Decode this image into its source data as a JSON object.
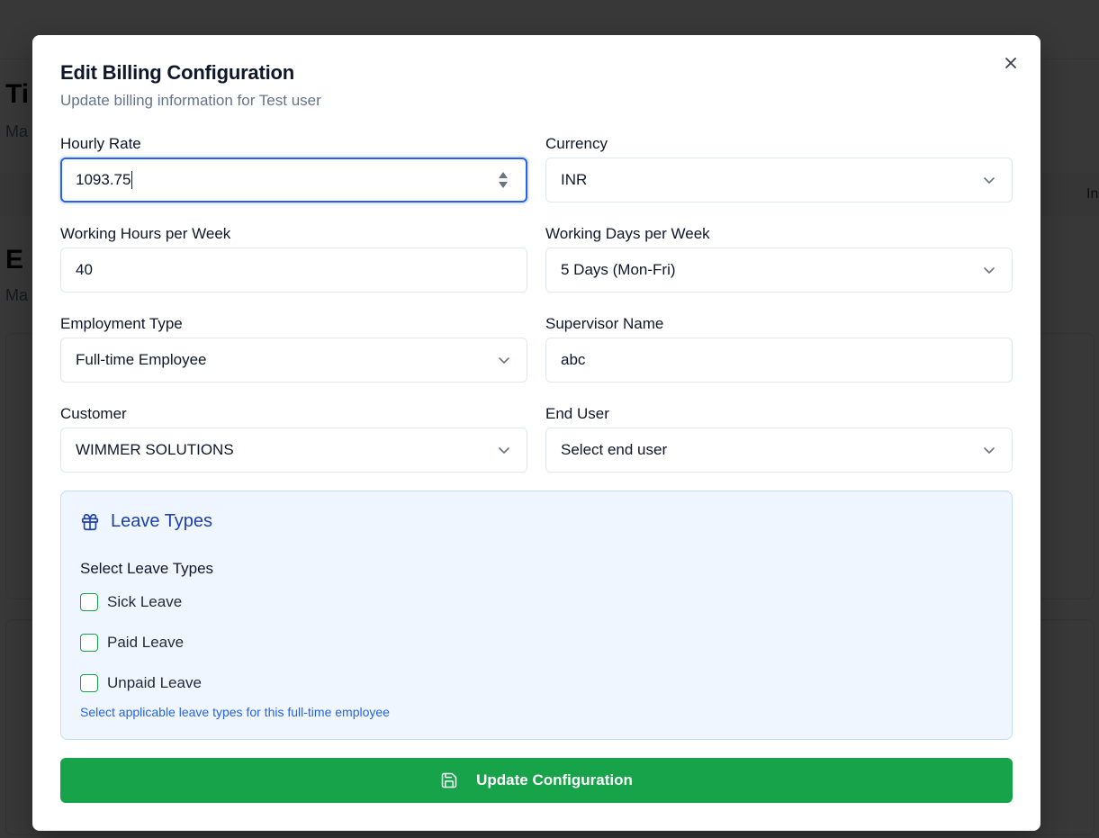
{
  "background": {
    "heading_partial": "Ti",
    "sub_partial": "Ma",
    "tab_partial": "In",
    "heading2_partial": "E",
    "sub2_partial": "Ma"
  },
  "modal": {
    "title": "Edit Billing Configuration",
    "description": "Update billing information for Test user",
    "close_icon": "x-icon"
  },
  "fields": {
    "hourly_rate": {
      "label": "Hourly Rate",
      "value": "1093.75"
    },
    "currency": {
      "label": "Currency",
      "value": "INR"
    },
    "working_hours": {
      "label": "Working Hours per Week",
      "value": "40"
    },
    "working_days": {
      "label": "Working Days per Week",
      "value": "5 Days (Mon-Fri)"
    },
    "employment_type": {
      "label": "Employment Type",
      "value": "Full-time Employee"
    },
    "supervisor": {
      "label": "Supervisor Name",
      "value": "abc"
    },
    "customer": {
      "label": "Customer",
      "value": "WIMMER SOLUTIONS"
    },
    "end_user": {
      "label": "End User",
      "value": "Select end user"
    }
  },
  "leave": {
    "title": "Leave Types",
    "subtitle": "Select Leave Types",
    "options": [
      {
        "label": "Sick Leave",
        "checked": false
      },
      {
        "label": "Paid Leave",
        "checked": false
      },
      {
        "label": "Unpaid Leave",
        "checked": false
      }
    ],
    "hint": "Select applicable leave types for this full-time employee"
  },
  "submit": {
    "label": "Update Configuration",
    "icon": "save-icon"
  },
  "colors": {
    "accent_blue": "#2563eb",
    "leave_bg": "#eff6ff",
    "button_green": "#16a34a"
  }
}
